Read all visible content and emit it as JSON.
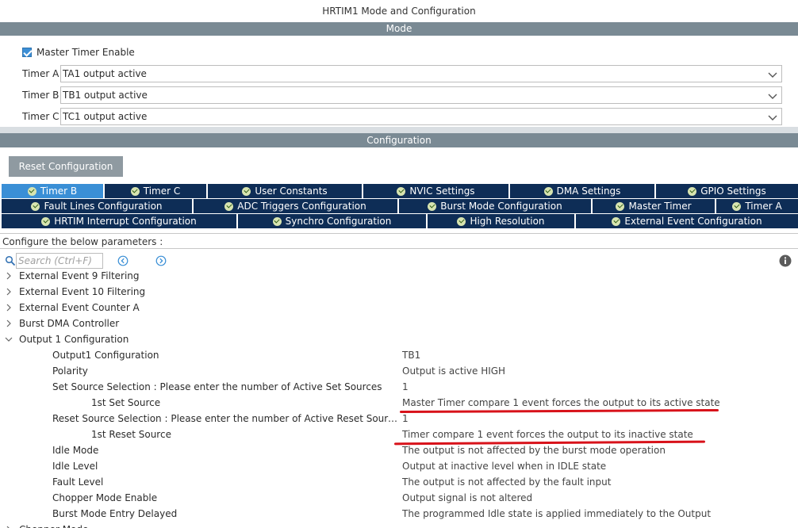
{
  "window_title": "HRTIM1 Mode and Configuration",
  "mode_section": {
    "title": "Mode",
    "master_timer_enable": {
      "label": "Master Timer Enable",
      "checked": true
    },
    "timers": [
      {
        "label": "Timer A",
        "value": "TA1 output active"
      },
      {
        "label": "Timer B",
        "value": "TB1 output active"
      },
      {
        "label": "Timer C",
        "value": "TC1 output active"
      }
    ]
  },
  "config_section": {
    "title": "Configuration",
    "reset_button": "Reset Configuration",
    "tabs_row1": [
      "Timer B",
      "Timer C",
      "User Constants",
      "NVIC Settings",
      "DMA Settings",
      "GPIO Settings"
    ],
    "tabs_row2": [
      "Fault Lines Configuration",
      "ADC Triggers Configuration",
      "Burst Mode Configuration",
      "Master Timer",
      "Timer A"
    ],
    "tabs_row3": [
      "HRTIM Interrupt Configuration",
      "Synchro Configuration",
      "High Resolution",
      "External Event Configuration"
    ],
    "active_tab": "Timer B",
    "hint": "Configure the below parameters :",
    "search_placeholder": "Search (Ctrl+F)"
  },
  "tree": {
    "groups": [
      {
        "label": "External Event 9 Filtering"
      },
      {
        "label": "External Event 10 Filtering"
      },
      {
        "label": "External Event Counter A"
      },
      {
        "label": "Burst DMA Controller"
      },
      {
        "label": "Output 1 Configuration",
        "expanded": true
      }
    ],
    "params": [
      {
        "name": "Output1 Configuration",
        "value": "TB1"
      },
      {
        "name": "Polarity",
        "value": "Output is active HIGH"
      },
      {
        "name": "Set Source  Selection : Please enter the number of Active Set Sources",
        "value": "1"
      },
      {
        "name": "1st Set Source",
        "value": "Master Timer compare 1 event forces the output to its active state"
      },
      {
        "name": "Reset Source  Selection : Please enter the number of Active Reset Sourc...",
        "value": "1"
      },
      {
        "name": "1st Reset Source",
        "value": "Timer compare 1 event forces the output to its inactive state"
      },
      {
        "name": "Idle Mode",
        "value": "The output is not affected by the burst mode operation"
      },
      {
        "name": "Idle Level",
        "value": "Output at inactive level when in IDLE state"
      },
      {
        "name": "Fault Level",
        "value": "The output is not affected by the fault input"
      },
      {
        "name": "Chopper Mode Enable",
        "value": "Output signal is not altered"
      },
      {
        "name": "Burst Mode Entry Delayed",
        "value": "The programmed Idle state is applied immediately to the Output"
      }
    ],
    "next_group_partial": "Chopper Mode"
  },
  "colors": {
    "band": "#7a8a94",
    "tab_bg": "#0e2d56",
    "tab_active": "#3a8fd6",
    "annotation": "#d8121a"
  }
}
